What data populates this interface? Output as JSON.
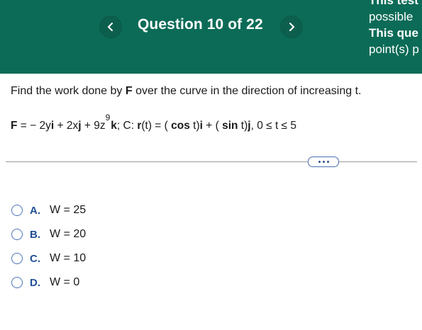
{
  "header": {
    "title": "Question 10 of 22",
    "side_lines": [
      "This test",
      "possible",
      "This que",
      "point(s) p"
    ],
    "colors": {
      "background": "#0b6b57",
      "text": "#ffffff"
    },
    "prev_icon": "chevron-left-icon",
    "next_icon": "chevron-right-icon"
  },
  "question": {
    "prompt_before": "Find the work done by ",
    "prompt_bold": "F",
    "prompt_after": " over the curve in the direction of increasing t.",
    "formula": {
      "p1": "F",
      "p2": " = − 2y",
      "p3": "i",
      "p4": " + 2x",
      "p5": "j",
      "p6": " + 9z",
      "exp": "9",
      "p7": "k",
      "p8": "; C: ",
      "p9": "r",
      "p10": "(t) = ( ",
      "p11": "cos",
      "p12": " t)",
      "p13": "i",
      "p14": " + ( ",
      "p15": "sin",
      "p16": " t)",
      "p17": "j",
      "p18": ",  0 ≤ t ≤ 5"
    }
  },
  "more_button_icon": "ellipsis-icon",
  "options": [
    {
      "letter": "A.",
      "text": "W = 25"
    },
    {
      "letter": "B.",
      "text": "W = 20"
    },
    {
      "letter": "C.",
      "text": "W = 10"
    },
    {
      "letter": "D.",
      "text": "W = 0"
    }
  ]
}
